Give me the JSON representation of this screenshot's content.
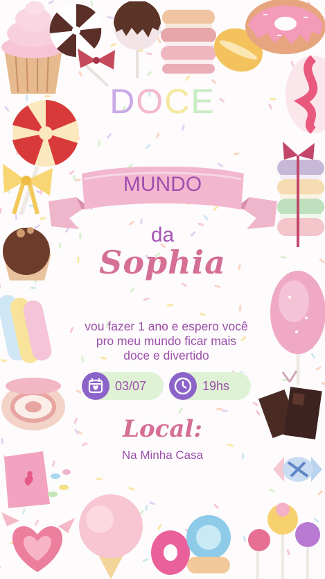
{
  "title": {
    "letters": [
      "D",
      "O",
      "C",
      "E"
    ],
    "colors": [
      "#c9a8e8",
      "#f3b8cf",
      "#f3e99c",
      "#c8ecc4"
    ]
  },
  "banner": {
    "text": "MUNDO"
  },
  "connector": "da",
  "name": "Sophia",
  "message": "vou fazer 1 ano e espero você pro meu mundo ficar mais doce e divertido",
  "details": {
    "date": {
      "icon": "calendar-icon",
      "value": "03/07"
    },
    "time": {
      "icon": "clock-icon",
      "value": "19hs"
    }
  },
  "location": {
    "heading": "Local:",
    "value": "Na Minha Casa"
  },
  "colors": {
    "accent_purple": "#8c63c8",
    "text_purple": "#9a4ea8",
    "name_pink": "#d56f95",
    "pill_green": "#dff2d6",
    "ribbon_pink": "#f2b7cf"
  }
}
